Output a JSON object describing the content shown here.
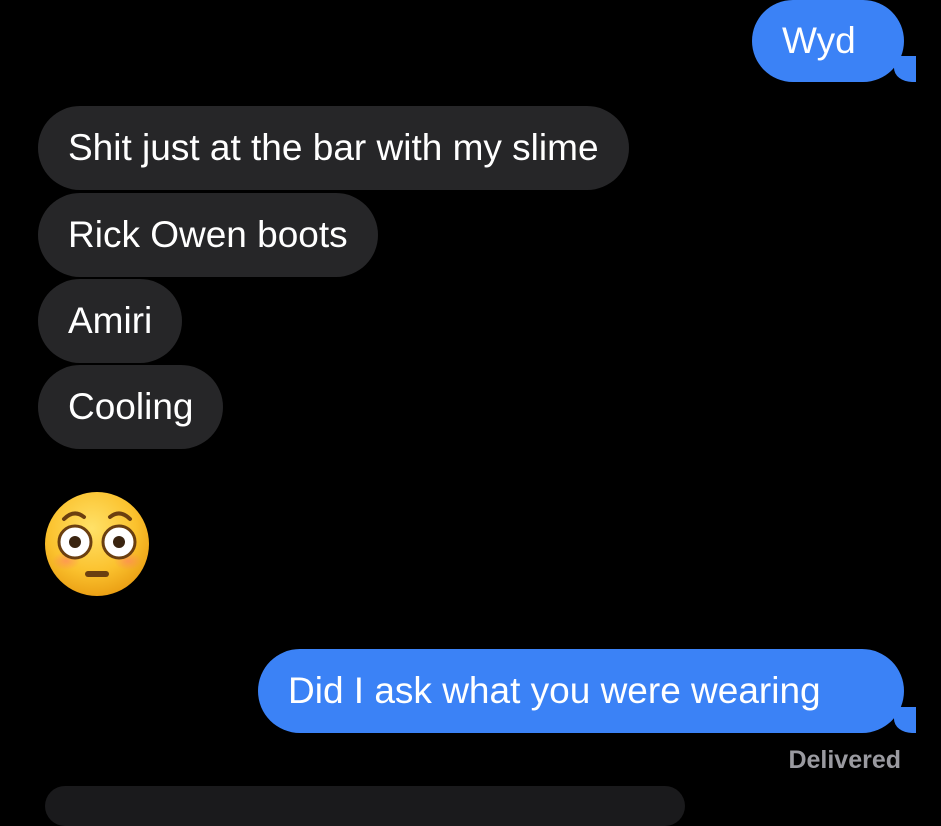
{
  "conversation": {
    "messages": [
      {
        "from": "me",
        "text": "Wyd"
      },
      {
        "from": "them",
        "text": "Shit just at the bar with my slime"
      },
      {
        "from": "them",
        "text": "Rick Owen boots"
      },
      {
        "from": "them",
        "text": "Amiri"
      },
      {
        "from": "them",
        "text": "Cooling"
      },
      {
        "from": "them",
        "emoji": "flushed-face-emoji"
      },
      {
        "from": "me",
        "text": "Did I ask what you were wearing"
      }
    ],
    "status": "Delivered"
  },
  "colors": {
    "background": "#000000",
    "outgoing_bubble": "#3b82f6",
    "incoming_bubble": "#262628",
    "status_text": "#9a9aa0"
  }
}
